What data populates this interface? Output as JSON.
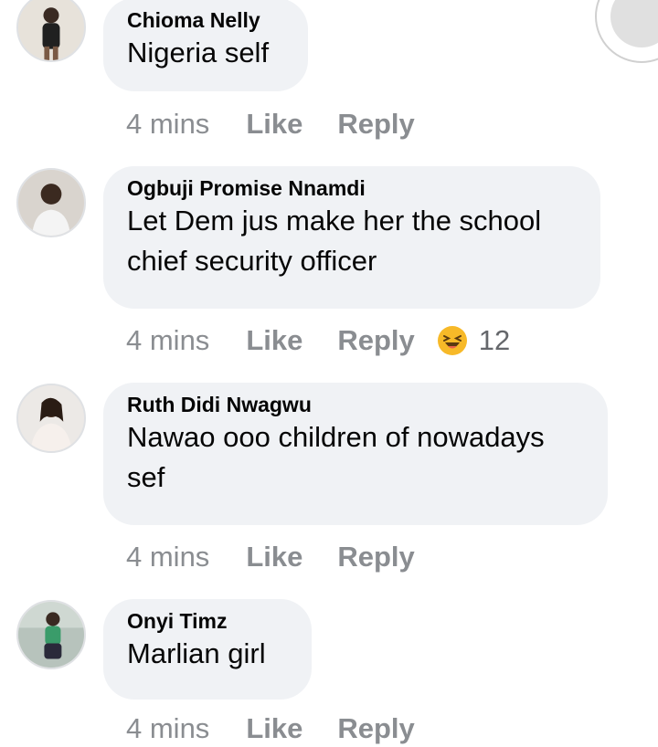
{
  "comments": [
    {
      "name": "Chioma Nelly",
      "text": "Nigeria self",
      "time": "4 mins",
      "like": "Like",
      "reply": "Reply"
    },
    {
      "name": "Ogbuji Promise Nnamdi",
      "text": "Let Dem jus make her the school chief security officer",
      "time": "4 mins",
      "like": "Like",
      "reply": "Reply",
      "reaction": {
        "icon": "laughing-emoji-icon",
        "count": "12"
      }
    },
    {
      "name": "Ruth Didi Nwagwu",
      "text": "Nawao ooo children of nowadays sef",
      "time": "4 mins",
      "like": "Like",
      "reply": "Reply"
    },
    {
      "name": "Onyi Timz",
      "text": "Marlian girl",
      "time": "4 mins",
      "like": "Like",
      "reply": "Reply"
    }
  ],
  "colors": {
    "bubble": "#f0f2f5",
    "meta_text": "#8a8d91",
    "name_text": "#050505",
    "reaction_emoji": "#f7b928"
  }
}
